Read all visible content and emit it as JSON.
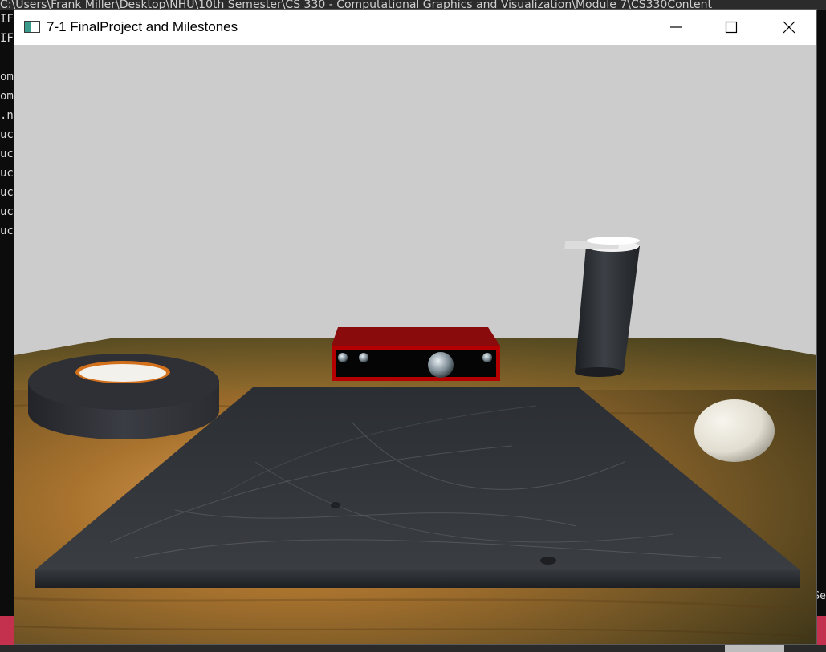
{
  "background_console": {
    "title_fragment": "C:\\Users\\Frank Miller\\Desktop\\NHU\\10th Semester\\CS 330 - Computational Graphics and Visualization\\Module 7\\CS330Content",
    "left_lines": [
      "IFO",
      "IFO",
      "",
      "omp",
      "omp",
      ".nl",
      "ucc",
      "ucc",
      "ucc",
      "ucc",
      "ucc",
      "ucc"
    ],
    "right_fragment": "Se"
  },
  "window": {
    "title": "7-1 FinalProject and Milestones",
    "icon": "app-window-icon",
    "controls": {
      "minimize": "minimize-icon",
      "maximize": "maximize-icon",
      "close": "close-icon"
    }
  },
  "scene": {
    "background_color": "#cccccc",
    "objects": [
      "wooden-table",
      "black-mat",
      "tape-roll",
      "audio-interface",
      "cylinder-canister",
      "ball"
    ],
    "colors": {
      "table_wood": "#7a5a2a",
      "mat": "#2a2d31",
      "interface_red": "#b40000",
      "tape_black": "#2e3035",
      "tape_orange": "#d2701c",
      "ball": "#e8e4da"
    }
  }
}
